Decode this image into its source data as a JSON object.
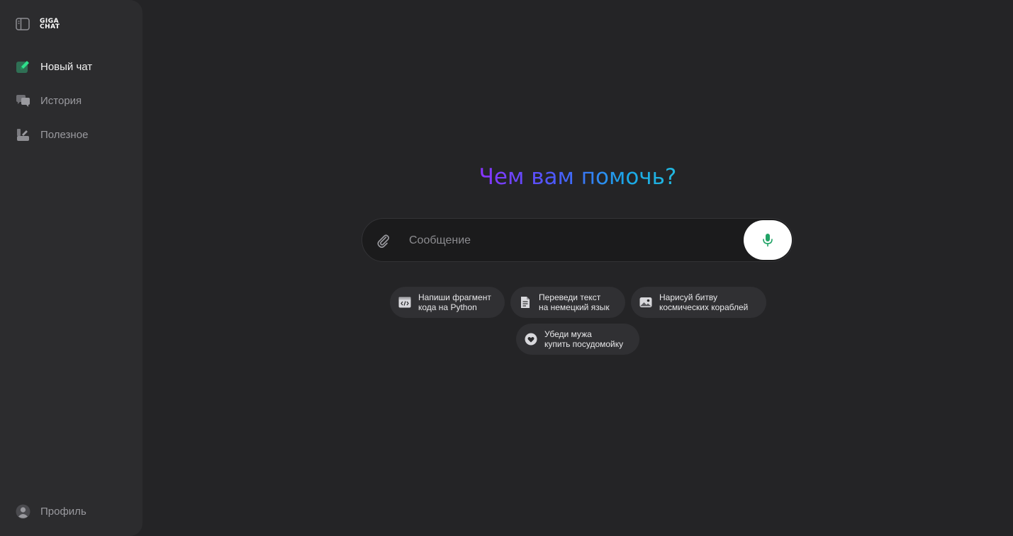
{
  "sidebar": {
    "logo_text": "GIGA CHAT",
    "toggle_icon": "sidebar-toggle-icon",
    "items": [
      {
        "label": "Новый чат",
        "icon": "new-chat-pencil-icon",
        "active": true
      },
      {
        "label": "История",
        "icon": "history-chat-bubbles-icon",
        "active": false
      },
      {
        "label": "Полезное",
        "icon": "useful-toolbox-icon",
        "active": false
      }
    ],
    "profile_label": "Профиль"
  },
  "main": {
    "heading": "Чем вам помочь?",
    "composer": {
      "placeholder": "Сообщение",
      "value": ""
    },
    "suggestions": [
      {
        "line1": "Напиши фрагмент",
        "line2": "кода на Python",
        "icon": "code-icon"
      },
      {
        "line1": "Переведи текст",
        "line2": "на немецкий язык",
        "icon": "document-icon"
      },
      {
        "line1": "Нарисуй битву",
        "line2": "космических кораблей",
        "icon": "image-icon"
      },
      {
        "line1": "Убеди мужа",
        "line2": "купить посудомойку",
        "icon": "heart-icon"
      }
    ]
  },
  "colors": {
    "accent_green": "#21a366",
    "gradient_start": "#8a33ff",
    "gradient_end": "#22b8e0",
    "background": "#242426",
    "sidebar": "#2c2c2e"
  }
}
